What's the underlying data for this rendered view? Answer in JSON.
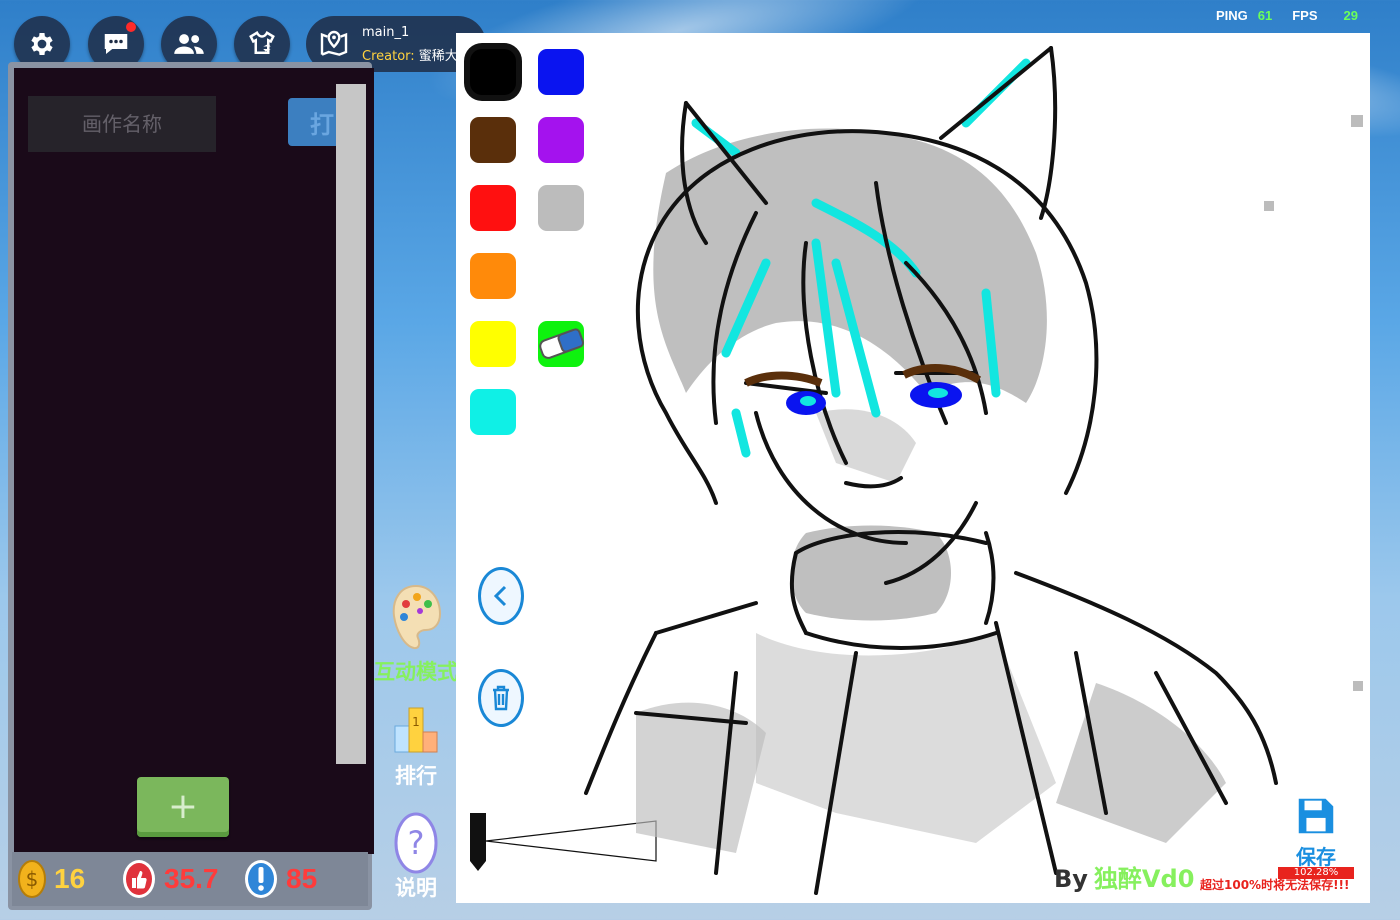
{
  "topbar": {
    "room": {
      "name": "main_1",
      "creator_label": "Creator:",
      "creator_name": "蜜稀大仙"
    },
    "net": {
      "ping_label": "PING",
      "ping_value": "61",
      "fps_label": "FPS",
      "fps_value": "29"
    }
  },
  "left_panel": {
    "name_input": {
      "placeholder": "画作名称",
      "value": ""
    },
    "open_label": "打",
    "add_label": "+",
    "stats": {
      "coins": "16",
      "likes": "35.7",
      "reports": "85"
    }
  },
  "side_menu": {
    "interactive_mode": "互动模式",
    "ranking": "排行",
    "help": "说明"
  },
  "canvas": {
    "palette": [
      {
        "name": "black",
        "color": "#000000",
        "selected": true
      },
      {
        "name": "blue",
        "color": "#0a14f0"
      },
      {
        "name": "brown",
        "color": "#5a2f0b"
      },
      {
        "name": "purple",
        "color": "#a412ee"
      },
      {
        "name": "red",
        "color": "#ff1010"
      },
      {
        "name": "gray",
        "color": "#bcbcbc"
      },
      {
        "name": "orange",
        "color": "#ff8a0a"
      },
      {
        "name": "white",
        "color": "#ffffff"
      },
      {
        "name": "yellow",
        "color": "#ffff00"
      },
      {
        "name": "green",
        "color": "#0ef20e"
      },
      {
        "name": "cyan",
        "color": "#0ff0e6"
      }
    ],
    "byline": {
      "by": "By",
      "author": "独醉Vd0"
    },
    "save": {
      "label": "保存",
      "capacity": "102.28%",
      "warning": "超过100%时将无法保存!!!"
    }
  }
}
